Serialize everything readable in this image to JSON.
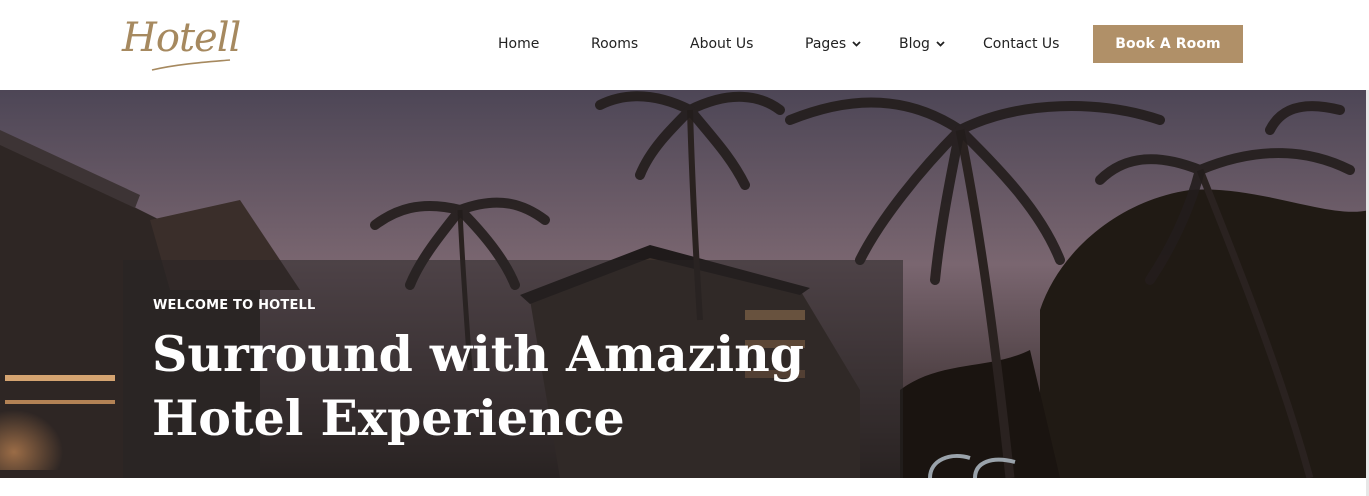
{
  "brand": {
    "logo_text": "Hotell",
    "accent_color": "#b09068"
  },
  "nav": {
    "items": [
      {
        "label": "Home",
        "has_dropdown": false
      },
      {
        "label": "Rooms",
        "has_dropdown": false
      },
      {
        "label": "About Us",
        "has_dropdown": false
      },
      {
        "label": "Pages",
        "has_dropdown": true
      },
      {
        "label": "Blog",
        "has_dropdown": true
      },
      {
        "label": "Contact Us",
        "has_dropdown": false
      }
    ],
    "cta_label": "Book A Room",
    "dropdown_icon": "chevron-down-icon"
  },
  "hero": {
    "kicker": "WELCOME TO HOTELL",
    "headline_line1": "Surround with Amazing",
    "headline_line2": "Hotel Experience"
  }
}
